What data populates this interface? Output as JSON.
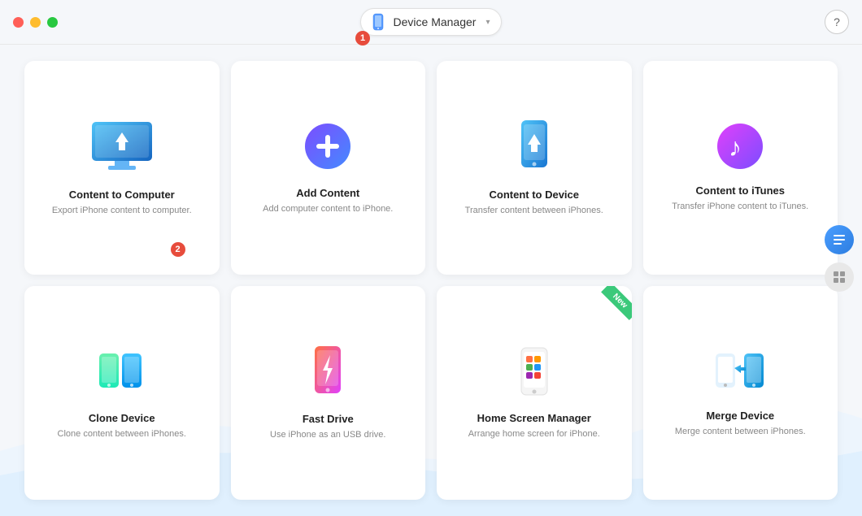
{
  "titlebar": {
    "app_title": "Device Manager",
    "dropdown_arrow": "▾",
    "help_label": "?",
    "badge1": "1",
    "badge2": "2"
  },
  "cards": [
    {
      "id": "content-to-computer",
      "title": "Content to Computer",
      "desc": "Export iPhone content to computer.",
      "has_badge": true,
      "badge": "2",
      "new": false
    },
    {
      "id": "add-content",
      "title": "Add Content",
      "desc": "Add computer content to iPhone.",
      "has_badge": false,
      "new": false
    },
    {
      "id": "content-to-device",
      "title": "Content to Device",
      "desc": "Transfer content between iPhones.",
      "has_badge": false,
      "new": false
    },
    {
      "id": "content-to-itunes",
      "title": "Content to iTunes",
      "desc": "Transfer iPhone content to iTunes.",
      "has_badge": false,
      "new": false
    },
    {
      "id": "clone-device",
      "title": "Clone Device",
      "desc": "Clone content between iPhones.",
      "has_badge": false,
      "new": false
    },
    {
      "id": "fast-drive",
      "title": "Fast Drive",
      "desc": "Use iPhone as an USB drive.",
      "has_badge": false,
      "new": false
    },
    {
      "id": "home-screen-manager",
      "title": "Home Screen Manager",
      "desc": "Arrange home screen for iPhone.",
      "has_badge": false,
      "new": true
    },
    {
      "id": "merge-device",
      "title": "Merge Device",
      "desc": "Merge content between iPhones.",
      "has_badge": false,
      "new": false
    }
  ],
  "side_buttons": {
    "manager_icon": "≡",
    "grid_icon": "⊞"
  },
  "new_label": "New"
}
